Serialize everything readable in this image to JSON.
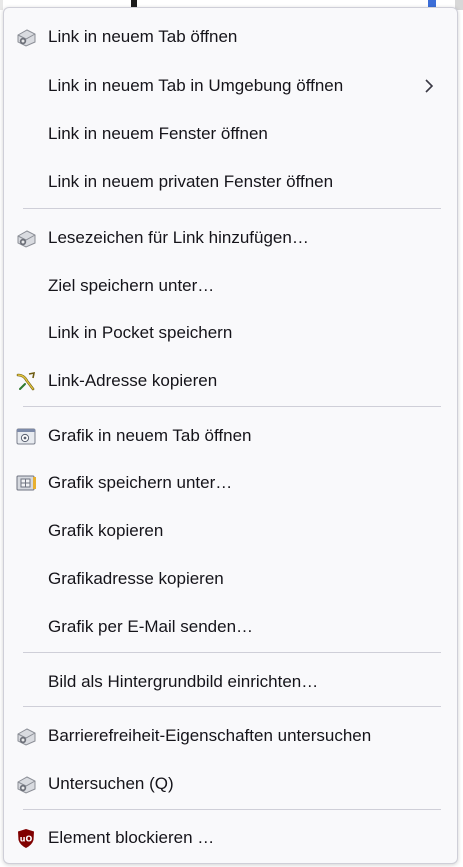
{
  "menu": {
    "items": [
      {
        "label": "Link in neuem Tab öffnen",
        "icon": "extension-icon"
      },
      {
        "label": "Link in neuem Tab in Umgebung öffnen",
        "submenu": true
      },
      {
        "label": "Link in neuem Fenster öffnen"
      },
      {
        "label": "Link in neuem privaten Fenster öffnen"
      },
      {
        "label": "Lesezeichen für Link hinzufügen…",
        "icon": "extension-icon"
      },
      {
        "label": "Ziel speichern unter…"
      },
      {
        "label": "Link in Pocket speichern"
      },
      {
        "label": "Link-Adresse kopieren",
        "icon": "link-copy-icon"
      },
      {
        "label": "Grafik in neuem Tab öffnen",
        "icon": "image-icon"
      },
      {
        "label": "Grafik speichern unter…",
        "icon": "image-save-icon"
      },
      {
        "label": "Grafik kopieren"
      },
      {
        "label": "Grafikadresse kopieren"
      },
      {
        "label": "Grafik per E-Mail senden…"
      },
      {
        "label": "Bild als Hintergrundbild einrichten…"
      },
      {
        "label": "Barrierefreiheit-Eigenschaften untersuchen",
        "icon": "extension-icon"
      },
      {
        "label": "Untersuchen (Q)",
        "icon": "extension-icon"
      },
      {
        "label": "Element blockieren …",
        "icon": "ublock-icon"
      }
    ]
  },
  "colors": {
    "menu_bg": "#f9f9fb",
    "separator": "#cfcfd8",
    "text": "#15141a",
    "ublock_red": "#800000"
  }
}
